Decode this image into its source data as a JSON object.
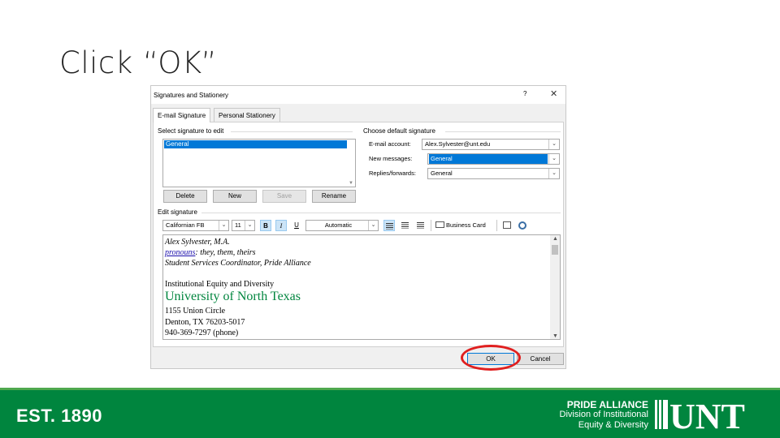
{
  "slide": {
    "title": "Click “OK”"
  },
  "dialog": {
    "title": "Signatures and Stationery",
    "help": "?",
    "close": "✕",
    "tabs": [
      {
        "label": "E-mail Signature",
        "active": true
      },
      {
        "label": "Personal Stationery",
        "active": false
      }
    ],
    "select_signature_label": "Select signature to edit",
    "signatures": [
      "General"
    ],
    "buttons": {
      "delete": "Delete",
      "new": "New",
      "save": "Save",
      "rename": "Rename"
    },
    "default_signature": {
      "group_label": "Choose default signature",
      "email_account_label": "E-mail account:",
      "email_account_value": "Alex.Sylvester@unt.edu",
      "new_messages_label": "New messages:",
      "new_messages_value": "General",
      "replies_label": "Replies/forwards:",
      "replies_value": "General"
    },
    "edit_signature_label": "Edit signature",
    "toolbar": {
      "font": "Californian FB",
      "size": "11",
      "bold": "B",
      "italic": "I",
      "underline": "U",
      "color": "Automatic",
      "business_card": "Business Card"
    },
    "signature_lines": {
      "name": "Alex Sylvester, M.A.",
      "pronouns_link": "pronouns",
      "pronouns_text": ": they, them, theirs",
      "role": "Student Services Coordinator, Pride Alliance",
      "dept": "Institutional Equity and Diversity",
      "university": "University of North Texas",
      "address1": "1155 Union Circle",
      "address2": "Denton, TX 76203-5017",
      "phone": "940-369-7297 (phone)"
    },
    "ok": "OK",
    "cancel": "Cancel"
  },
  "footer": {
    "est": "EST. 1890",
    "pride_title": "PRIDE ALLIANCE",
    "pride_sub1": "Division of Institutional",
    "pride_sub2": "Equity & Diversity",
    "logo_text": "UNT",
    "colors": {
      "green": "#00853e",
      "highlight": "#e01f1f"
    }
  }
}
